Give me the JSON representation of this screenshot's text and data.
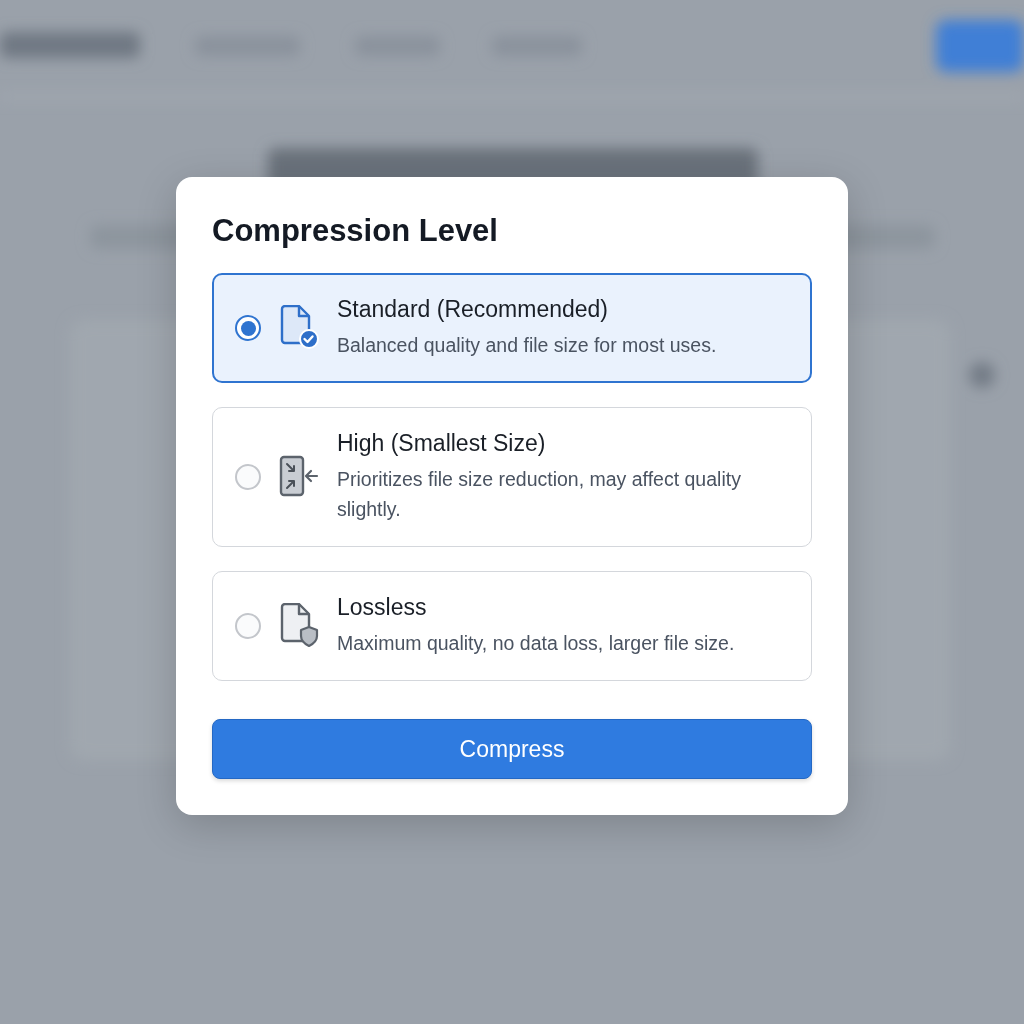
{
  "dialog": {
    "title": "Compression Level",
    "options": [
      {
        "kind": "standard",
        "title": "Standard (Recommended)",
        "description": "Balanced quality and file size for most uses.",
        "selected": true
      },
      {
        "kind": "high",
        "title": "High (Smallest Size)",
        "description": "Prioritizes file size reduction, may affect quality slightly.",
        "selected": false
      },
      {
        "kind": "lossless",
        "title": "Lossless",
        "description": "Maximum quality, no data loss, larger file size.",
        "selected": false
      }
    ],
    "button": "Compress"
  }
}
